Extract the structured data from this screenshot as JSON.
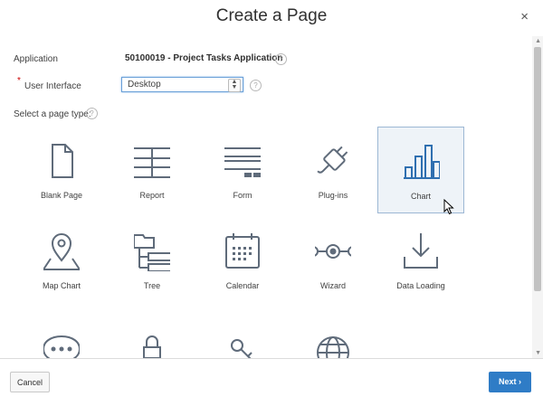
{
  "dialog": {
    "title": "Create a Page",
    "close_symbol": "×"
  },
  "form": {
    "application_label": "Application",
    "application_value": "50100019 - Project Tasks Application",
    "required_marker": "*",
    "ui_label": "User Interface",
    "ui_value": "Desktop",
    "page_type_label": "Select a page type:",
    "help_symbol": "?"
  },
  "page_types": [
    {
      "label": "Blank Page",
      "icon": "blank-page-icon"
    },
    {
      "label": "Report",
      "icon": "report-icon"
    },
    {
      "label": "Form",
      "icon": "form-icon"
    },
    {
      "label": "Plug-ins",
      "icon": "plugin-icon"
    },
    {
      "label": "Chart",
      "icon": "bar-chart-icon",
      "selected": true
    },
    {
      "label": "Map Chart",
      "icon": "map-pin-icon"
    },
    {
      "label": "Tree",
      "icon": "tree-icon"
    },
    {
      "label": "Calendar",
      "icon": "calendar-icon"
    },
    {
      "label": "Wizard",
      "icon": "wizard-steps-icon"
    },
    {
      "label": "Data Loading",
      "icon": "download-icon"
    },
    {
      "label": "",
      "icon": "chat-bubble-icon"
    },
    {
      "label": "",
      "icon": "lock-icon"
    },
    {
      "label": "",
      "icon": "key-icon"
    },
    {
      "label": "",
      "icon": "globe-icon"
    }
  ],
  "footer": {
    "cancel_label": "Cancel",
    "next_label": "Next",
    "next_symbol": "›"
  },
  "colors": {
    "icon": "#5f6b7a",
    "primary": "#2f7cc6",
    "selected_tile_bg": "#eef3f8",
    "selected_tile_border": "#9cb7d4"
  }
}
